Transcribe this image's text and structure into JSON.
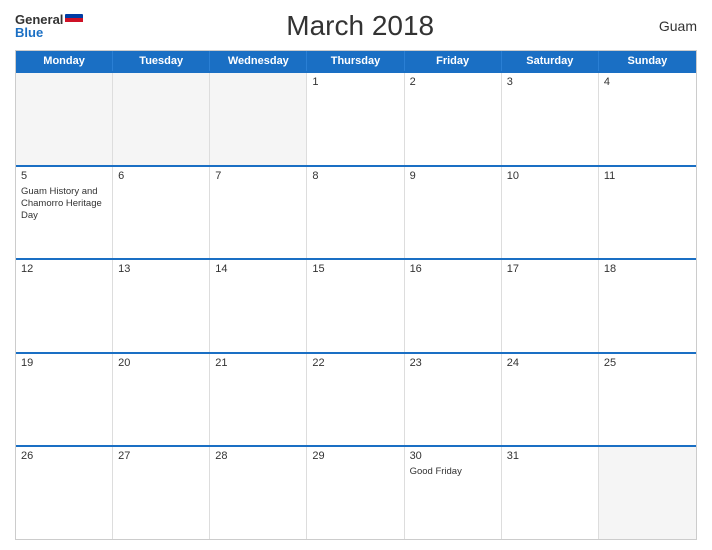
{
  "header": {
    "title": "March 2018",
    "region": "Guam",
    "logo_general": "General",
    "logo_blue": "Blue"
  },
  "days_of_week": [
    "Monday",
    "Tuesday",
    "Wednesday",
    "Thursday",
    "Friday",
    "Saturday",
    "Sunday"
  ],
  "weeks": [
    [
      {
        "day": "",
        "empty": true
      },
      {
        "day": "",
        "empty": true
      },
      {
        "day": "",
        "empty": true
      },
      {
        "day": "1",
        "empty": false,
        "event": ""
      },
      {
        "day": "2",
        "empty": false,
        "event": ""
      },
      {
        "day": "3",
        "empty": false,
        "event": ""
      },
      {
        "day": "4",
        "empty": false,
        "event": ""
      }
    ],
    [
      {
        "day": "5",
        "empty": false,
        "event": "Guam History and Chamorro Heritage Day"
      },
      {
        "day": "6",
        "empty": false,
        "event": ""
      },
      {
        "day": "7",
        "empty": false,
        "event": ""
      },
      {
        "day": "8",
        "empty": false,
        "event": ""
      },
      {
        "day": "9",
        "empty": false,
        "event": ""
      },
      {
        "day": "10",
        "empty": false,
        "event": ""
      },
      {
        "day": "11",
        "empty": false,
        "event": ""
      }
    ],
    [
      {
        "day": "12",
        "empty": false,
        "event": ""
      },
      {
        "day": "13",
        "empty": false,
        "event": ""
      },
      {
        "day": "14",
        "empty": false,
        "event": ""
      },
      {
        "day": "15",
        "empty": false,
        "event": ""
      },
      {
        "day": "16",
        "empty": false,
        "event": ""
      },
      {
        "day": "17",
        "empty": false,
        "event": ""
      },
      {
        "day": "18",
        "empty": false,
        "event": ""
      }
    ],
    [
      {
        "day": "19",
        "empty": false,
        "event": ""
      },
      {
        "day": "20",
        "empty": false,
        "event": ""
      },
      {
        "day": "21",
        "empty": false,
        "event": ""
      },
      {
        "day": "22",
        "empty": false,
        "event": ""
      },
      {
        "day": "23",
        "empty": false,
        "event": ""
      },
      {
        "day": "24",
        "empty": false,
        "event": ""
      },
      {
        "day": "25",
        "empty": false,
        "event": ""
      }
    ],
    [
      {
        "day": "26",
        "empty": false,
        "event": ""
      },
      {
        "day": "27",
        "empty": false,
        "event": ""
      },
      {
        "day": "28",
        "empty": false,
        "event": ""
      },
      {
        "day": "29",
        "empty": false,
        "event": ""
      },
      {
        "day": "30",
        "empty": false,
        "event": "Good Friday"
      },
      {
        "day": "31",
        "empty": false,
        "event": ""
      },
      {
        "day": "",
        "empty": true
      }
    ]
  ]
}
